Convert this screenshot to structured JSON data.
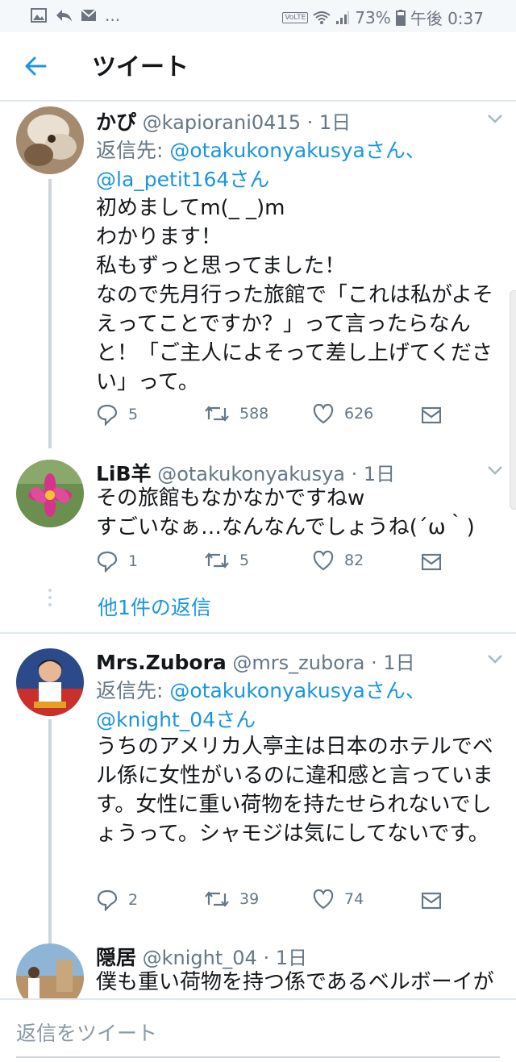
{
  "status_bar": {
    "left_icons": [
      "image-icon",
      "reply-icon",
      "mail-icon"
    ],
    "ellipsis": "...",
    "volte": "VoLTE",
    "battery_percent": "73%",
    "time": "午後 0:37"
  },
  "header": {
    "title": "ツイート"
  },
  "tweets": [
    {
      "name": "かぴ",
      "handle": "@kapiorani0415",
      "time": "· 1日",
      "reply_label": "返信先: ",
      "reply_mentions_1": "@otakukonyakusyaさん、",
      "reply_mentions_2": "@la_petit164さん",
      "text": "初めましてm(_ _)m\nわかります！\n私もずっと思ってました！\nなので先月行った旅館で「これは私がよそえってことですか？」って言ったらなんと！「ご主人によそって差し上げてください」って。",
      "replies": "5",
      "retweets": "588",
      "likes": "626"
    },
    {
      "name": "LiB羊",
      "handle": "@otakukonyakusya",
      "time": "· 1日",
      "text": "その旅館もなかなかですねw\nすごいなぁ…なんなんでしょうね(´ω｀)",
      "replies": "1",
      "retweets": "5",
      "likes": "82"
    },
    {
      "name": "Mrs.Zubora",
      "handle": "@mrs_zubora",
      "time": "· 1日",
      "reply_label": "返信先: ",
      "reply_mentions_1": "@otakukonyakusyaさん、",
      "reply_mentions_2": "@knight_04さん",
      "text": "うちのアメリカ人亭主は日本のホテルでベル係に女性がいるのに違和感と言っています。女性に重い荷物を持たせられないでしょうって。シャモジは気にしてないです。",
      "replies": "2",
      "retweets": "39",
      "likes": "74"
    },
    {
      "name": "隠居",
      "handle": "@knight_04",
      "time": "· 1日",
      "text": "僕も重い荷物を持つ係であるベルボーイが"
    }
  ],
  "more_replies": "他1件の返信",
  "reply_bar": {
    "placeholder": "返信をツイート"
  },
  "colors": {
    "link": "#1b95e0",
    "muted": "#657786",
    "divider": "#e1e8ed"
  }
}
